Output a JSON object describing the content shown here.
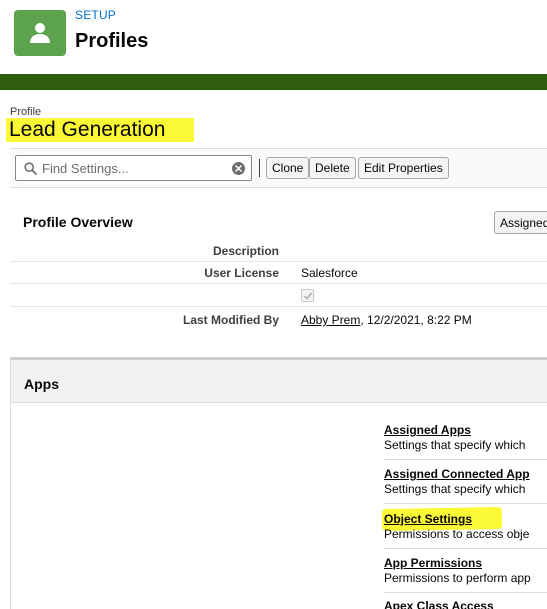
{
  "setup_header": {
    "label": "SETUP",
    "title": "Profiles",
    "icon": "user-icon",
    "icon_bg": "#5da34e",
    "band_color": "#2e5d0f"
  },
  "profile": {
    "label": "Profile",
    "name": "Lead Generation"
  },
  "toolbar": {
    "search_placeholder": "Find Settings...",
    "clone_label": "Clone",
    "delete_label": "Delete",
    "edit_label": "Edit Properties"
  },
  "overview": {
    "title": "Profile Overview",
    "assigned_button": "Assigned",
    "rows": [
      {
        "label": "Description",
        "value": ""
      },
      {
        "label": "User License",
        "value": "Salesforce"
      },
      {
        "label": "",
        "value": "",
        "checkbox": true,
        "checked": true
      },
      {
        "label": "Last Modified By",
        "user": "Abby Prem",
        "value": ", 12/2/2021, 8:22 PM"
      }
    ]
  },
  "apps": {
    "title": "Apps",
    "items": [
      {
        "link": "Assigned Apps",
        "desc": "Settings that specify which"
      },
      {
        "link": "Assigned Connected App",
        "desc": "Settings that specify which"
      },
      {
        "link": "Object Settings",
        "desc": "Permissions to access obje"
      },
      {
        "link": "App Permissions",
        "desc": "Permissions to perform app"
      },
      {
        "link": "Apex Class Access",
        "desc": ""
      }
    ]
  },
  "highlight_color": "#fbf935"
}
